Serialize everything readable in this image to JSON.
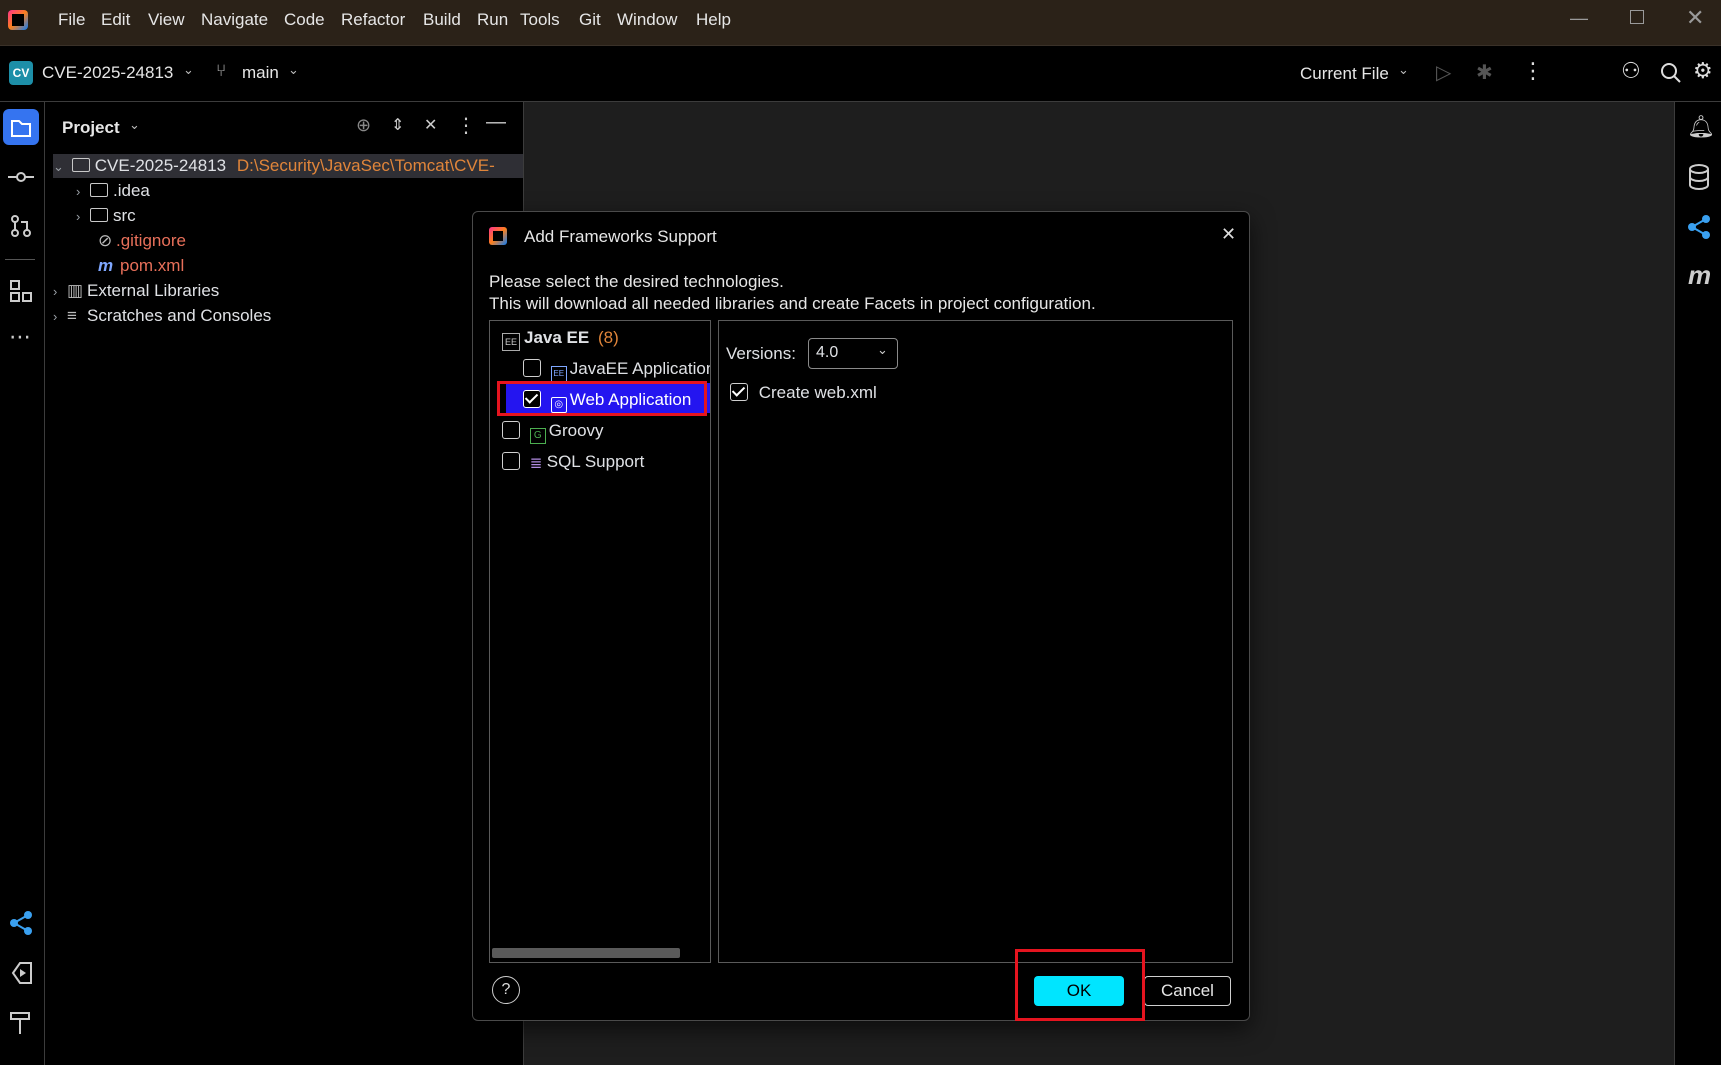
{
  "menu": [
    "File",
    "Edit",
    "View",
    "Navigate",
    "Code",
    "Refactor",
    "Build",
    "Run",
    "Tools",
    "Git",
    "Window",
    "Help"
  ],
  "toolbar": {
    "project_badge": "CV",
    "project_name": "CVE-2025-24813",
    "branch": "main",
    "run_config": "Current File"
  },
  "project_panel": {
    "title": "Project",
    "root_name": "CVE-2025-24813",
    "root_path": "D:\\Security\\JavaSec\\Tomcat\\CVE-",
    "items": [
      ".idea",
      "src",
      ".gitignore",
      "pom.xml"
    ],
    "external_libraries": "External Libraries",
    "scratches": "Scratches and Consoles"
  },
  "dialog": {
    "title": "Add Frameworks Support",
    "line1": "Please select the desired technologies.",
    "line2": "This will download all needed libraries and create Facets in project configuration.",
    "tree": {
      "group_label": "Java EE",
      "group_count": "(8)",
      "items": [
        {
          "label": "JavaEE Application",
          "checked": false
        },
        {
          "label": "Web Application",
          "checked": true,
          "selected": true
        },
        {
          "label": "Groovy",
          "checked": false
        },
        {
          "label": "SQL Support",
          "checked": false
        }
      ]
    },
    "versions_label": "Versions:",
    "version_value": "4.0",
    "create_webxml_label": "Create web.xml",
    "create_webxml_checked": true,
    "help_label": "?",
    "ok_label": "OK",
    "cancel_label": "Cancel"
  },
  "colors": {
    "accent": "#3574f0",
    "selection": "#2415f0",
    "ok_button": "#00e5ff",
    "highlight": "#e5141f",
    "path_text": "#e0853a",
    "ignored_text": "#e8705a"
  }
}
